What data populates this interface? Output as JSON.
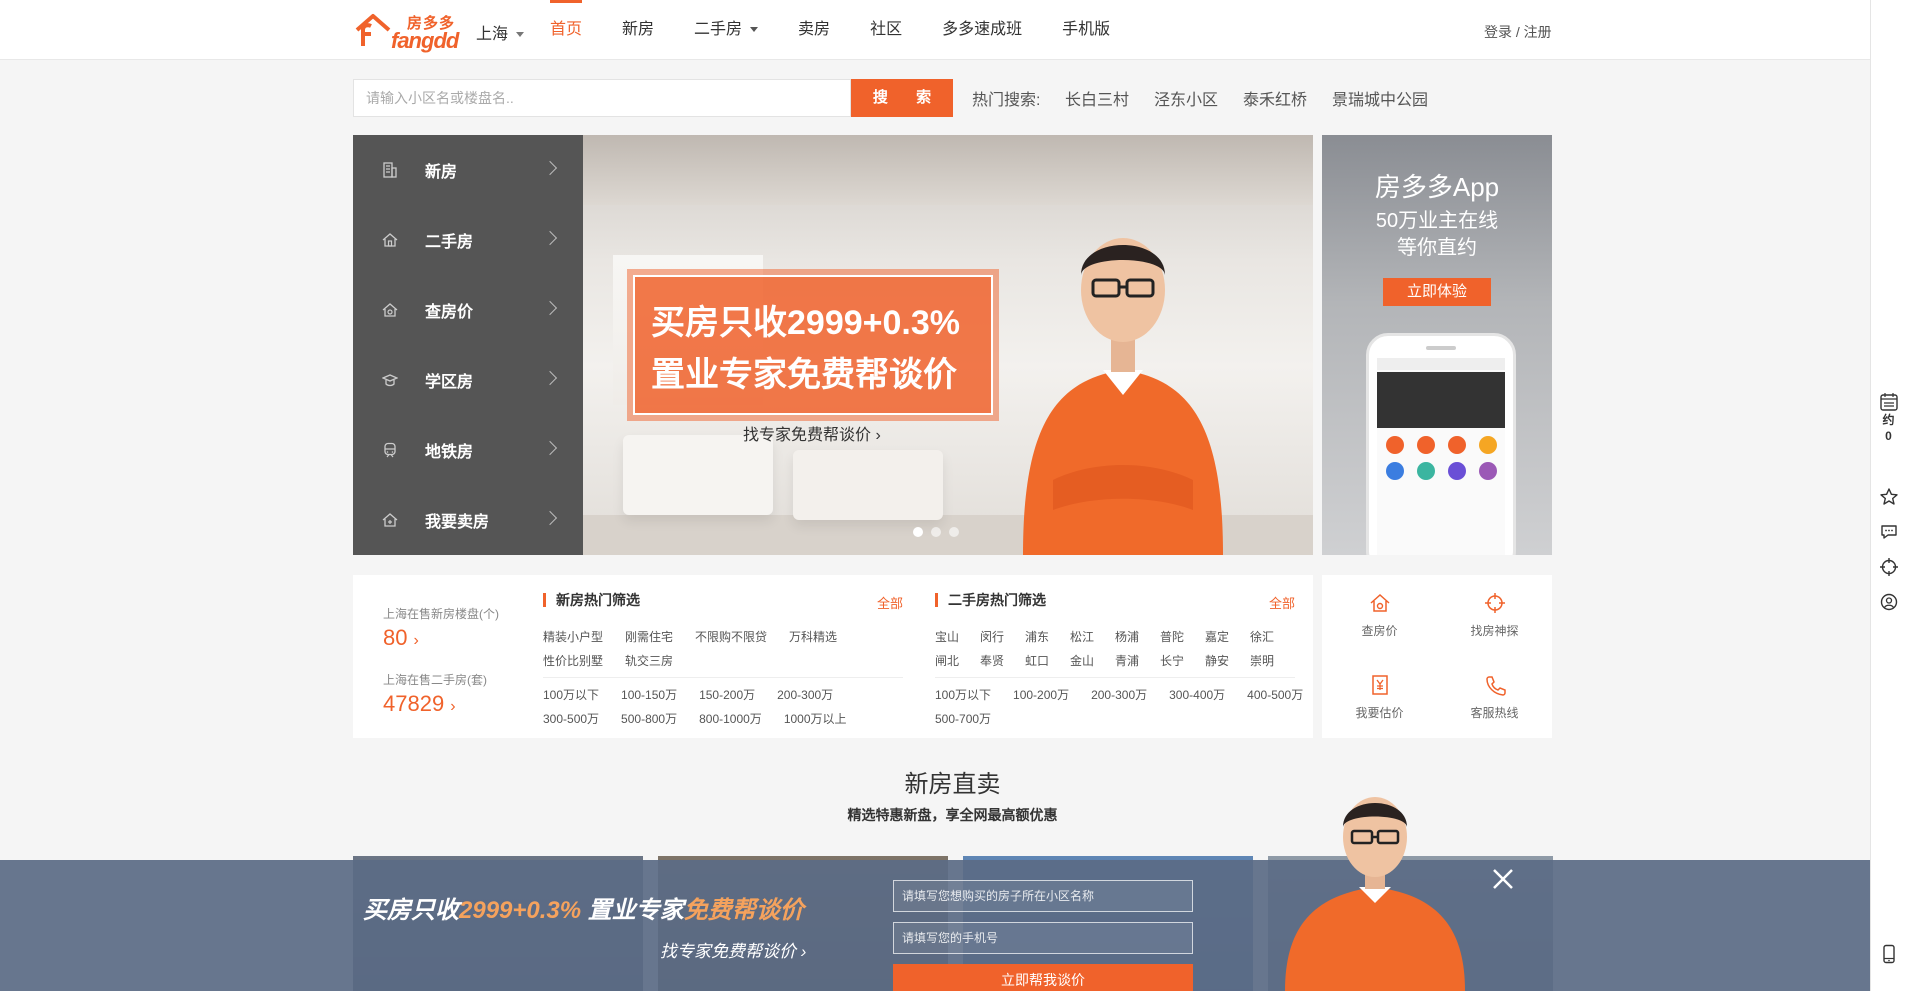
{
  "header": {
    "logo_cn": "房多多",
    "logo_en": "fangdd",
    "city": "上海",
    "nav": [
      {
        "label": "首页",
        "active": true,
        "dropdown": false
      },
      {
        "label": "新房",
        "active": false,
        "dropdown": false
      },
      {
        "label": "二手房",
        "active": false,
        "dropdown": true
      },
      {
        "label": "卖房",
        "active": false,
        "dropdown": false
      },
      {
        "label": "社区",
        "active": false,
        "dropdown": false
      },
      {
        "label": "多多速成班",
        "active": false,
        "dropdown": false
      },
      {
        "label": "手机版",
        "active": false,
        "dropdown": false
      }
    ],
    "login": "登录 / 注册"
  },
  "search": {
    "placeholder": "请输入小区名或楼盘名..",
    "button": "搜 索",
    "hot_label": "热门搜索:",
    "hot_links": [
      "长白三村",
      "泾东小区",
      "泰禾红桥",
      "景瑞城中公园"
    ]
  },
  "categories": [
    {
      "label": "新房",
      "icon": "building-icon"
    },
    {
      "label": "二手房",
      "icon": "house-icon"
    },
    {
      "label": "查房价",
      "icon": "house-price-icon"
    },
    {
      "label": "学区房",
      "icon": "graduation-cap-icon"
    },
    {
      "label": "地铁房",
      "icon": "subway-icon"
    },
    {
      "label": "我要卖房",
      "icon": "sell-house-icon"
    }
  ],
  "banner": {
    "headline_1": "买房只收2999+0.3%",
    "headline_2": "置业专家免费帮谈价",
    "link": "找专家免费帮谈价 ›"
  },
  "app_ad": {
    "title": "房多多App",
    "line_1": "50万业主在线",
    "line_2": "等你直约",
    "button": "立即体验"
  },
  "stats": {
    "new_label": "上海在售新房楼盘(个)",
    "new_count": "80",
    "second_label": "上海在售二手房(套)",
    "second_count": "47829"
  },
  "new_filter": {
    "title": "新房热门筛选",
    "all": "全部",
    "tags": [
      "精装小户型",
      "刚需住宅",
      "不限购不限贷",
      "万科精选",
      "性价比别墅",
      "轨交三房"
    ],
    "prices": [
      "100万以下",
      "100-150万",
      "150-200万",
      "200-300万",
      "300-500万",
      "500-800万",
      "800-1000万",
      "1000万以上"
    ]
  },
  "second_filter": {
    "title": "二手房热门筛选",
    "all": "全部",
    "districts": [
      "宝山",
      "闵行",
      "浦东",
      "松江",
      "杨浦",
      "普陀",
      "嘉定",
      "徐汇",
      "闸北",
      "奉贤",
      "虹口",
      "金山",
      "青浦",
      "长宁",
      "静安",
      "崇明"
    ],
    "prices": [
      "100万以下",
      "100-200万",
      "200-300万",
      "300-400万",
      "400-500万",
      "500-700万"
    ]
  },
  "tools": [
    {
      "label": "查房价",
      "icon": "house-price-icon"
    },
    {
      "label": "找房神探",
      "icon": "crosshair-icon"
    },
    {
      "label": "我要估价",
      "icon": "yuan-doc-icon"
    },
    {
      "label": "客服热线",
      "icon": "phone-icon"
    }
  ],
  "section": {
    "title": "新房直卖",
    "subtitle": "精选特惠新盘，享全网最高额优惠"
  },
  "right_bar": {
    "appoint_label": "约",
    "appoint_count": "0"
  },
  "overlay": {
    "text_plain_1": "买房只收",
    "text_hl_1": "2999+0.3%",
    "text_plain_2": " 置业专家",
    "text_hl_2": "免费帮谈价",
    "link": "找专家免费帮谈价 ›",
    "input_1_placeholder": "请填写您想购买的房子所在小区名称",
    "input_2_placeholder": "请填写您的手机号",
    "button": "立即帮我谈价"
  },
  "colors": {
    "accent": "#f0622b",
    "menu_bg": "#555555",
    "overlay_bg": "#5b6c85"
  }
}
